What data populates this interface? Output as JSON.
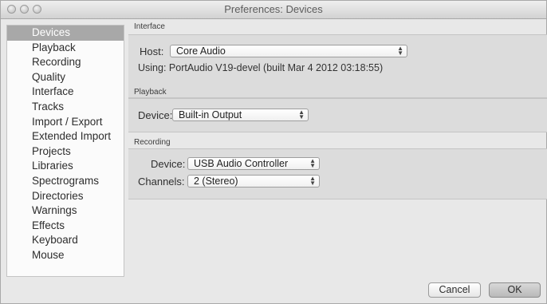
{
  "window": {
    "title": "Preferences: Devices"
  },
  "sidebar": {
    "items": [
      {
        "label": "Devices",
        "selected": true
      },
      {
        "label": "Playback"
      },
      {
        "label": "Recording"
      },
      {
        "label": "Quality"
      },
      {
        "label": "Interface"
      },
      {
        "label": "Tracks"
      },
      {
        "label": "Import / Export"
      },
      {
        "label": "Extended Import"
      },
      {
        "label": "Projects"
      },
      {
        "label": "Libraries"
      },
      {
        "label": "Spectrograms"
      },
      {
        "label": "Directories"
      },
      {
        "label": "Warnings"
      },
      {
        "label": "Effects"
      },
      {
        "label": "Keyboard"
      },
      {
        "label": "Mouse"
      }
    ]
  },
  "interface": {
    "title": "Interface",
    "host_label": "Host:",
    "host_value": "Core Audio",
    "using_text": "Using: PortAudio V19-devel (built Mar  4 2012 03:18:55)"
  },
  "playback": {
    "title": "Playback",
    "device_label": "Device:",
    "device_value": "Built-in Output"
  },
  "recording": {
    "title": "Recording",
    "device_label": "Device:",
    "device_value": "USB Audio Controller",
    "channels_label": "Channels:",
    "channels_value": "2 (Stereo)"
  },
  "buttons": {
    "cancel": "Cancel",
    "ok": "OK"
  },
  "icons": {
    "popup_arrows": "up-down-arrows-icon"
  }
}
